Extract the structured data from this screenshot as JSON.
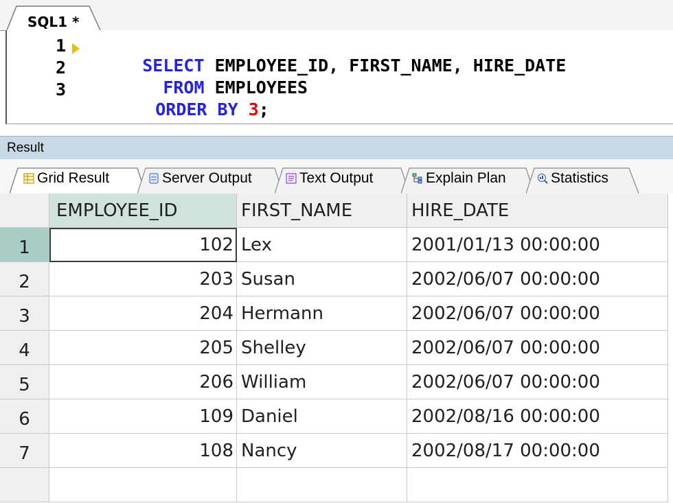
{
  "editor": {
    "tab_title": "SQL1 *",
    "line_numbers": [
      "1",
      "2",
      "3"
    ],
    "lines": [
      {
        "parts": [
          {
            "t": "SELECT",
            "k": "kw"
          },
          {
            "t": " EMPLOYEE_ID, FIRST_NAME, HIRE_DATE",
            "k": ""
          }
        ]
      },
      {
        "parts": [
          {
            "t": "  FROM",
            "k": "kw"
          },
          {
            "t": " EMPLOYEES",
            "k": ""
          }
        ]
      },
      {
        "parts": [
          {
            "t": "ORDER BY ",
            "k": "kw"
          },
          {
            "t": "3",
            "k": "num"
          },
          {
            "t": ";",
            "k": ""
          }
        ]
      }
    ]
  },
  "result": {
    "title": "Result",
    "tabs": [
      {
        "label": "Grid Result",
        "icon": "grid-result-icon"
      },
      {
        "label": "Server Output",
        "icon": "server-output-icon"
      },
      {
        "label": "Text Output",
        "icon": "text-output-icon"
      },
      {
        "label": "Explain Plan",
        "icon": "explain-plan-icon"
      },
      {
        "label": "Statistics",
        "icon": "statistics-icon"
      }
    ]
  },
  "grid": {
    "columns": [
      "EMPLOYEE_ID",
      "FIRST_NAME",
      "HIRE_DATE"
    ],
    "rows": [
      {
        "n": "1",
        "id": "102",
        "name": "Lex",
        "date": "2001/01/13 00:00:00"
      },
      {
        "n": "2",
        "id": "203",
        "name": "Susan",
        "date": "2002/06/07 00:00:00"
      },
      {
        "n": "3",
        "id": "204",
        "name": "Hermann",
        "date": "2002/06/07 00:00:00"
      },
      {
        "n": "4",
        "id": "205",
        "name": "Shelley",
        "date": "2002/06/07 00:00:00"
      },
      {
        "n": "5",
        "id": "206",
        "name": "William",
        "date": "2002/06/07 00:00:00"
      },
      {
        "n": "6",
        "id": "109",
        "name": "Daniel",
        "date": "2002/08/16 00:00:00"
      },
      {
        "n": "7",
        "id": "108",
        "name": "Nancy",
        "date": "2002/08/17 00:00:00"
      }
    ]
  },
  "colors": {
    "keyword": "#2323e0",
    "number": "#e00000",
    "selected_row_header": "#a9cdc4",
    "result_header": "#c8d9e6"
  }
}
